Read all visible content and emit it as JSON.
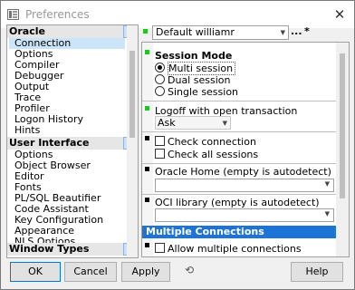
{
  "window": {
    "title": "Preferences",
    "close_glyph": "✕"
  },
  "tree": {
    "categories": [
      {
        "label": "Oracle",
        "items": [
          "Connection",
          "Options",
          "Compiler",
          "Debugger",
          "Output",
          "Trace",
          "Profiler",
          "Logon History",
          "Hints"
        ]
      },
      {
        "label": "User Interface",
        "items": [
          "Options",
          "Object Browser",
          "Editor",
          "Fonts",
          "PL/SQL Beautifier",
          "Code Assistant",
          "Key Configuration",
          "Appearance",
          "NLS Options"
        ]
      },
      {
        "label": "Window Types",
        "items": []
      }
    ],
    "selected": "Connection",
    "collapse_glyph": "▼"
  },
  "profile": {
    "value": "Default williamr",
    "more_label": "...",
    "star_label": "*"
  },
  "settings": {
    "session_mode": {
      "title": "Session Mode",
      "options": [
        "Multi session",
        "Dual session",
        "Single session"
      ],
      "selected": "Multi session"
    },
    "logoff": {
      "label": "Logoff with open transaction",
      "value": "Ask"
    },
    "checks": {
      "check_connection": "Check connection",
      "check_all_sessions": "Check all sessions"
    },
    "oracle_home": {
      "label": "Oracle Home (empty is autodetect)",
      "value": ""
    },
    "oci_library": {
      "label": "OCI library (empty is autodetect)",
      "value": ""
    },
    "multiple_connections": {
      "title": "Multiple Connections",
      "allow_label": "Allow multiple connections"
    }
  },
  "buttons": {
    "ok": "OK",
    "cancel": "Cancel",
    "apply": "Apply",
    "help": "Help"
  },
  "colors": {
    "accent": "#1e73d6",
    "selection": "#cce4f7",
    "modified_marker": "#22c322"
  }
}
